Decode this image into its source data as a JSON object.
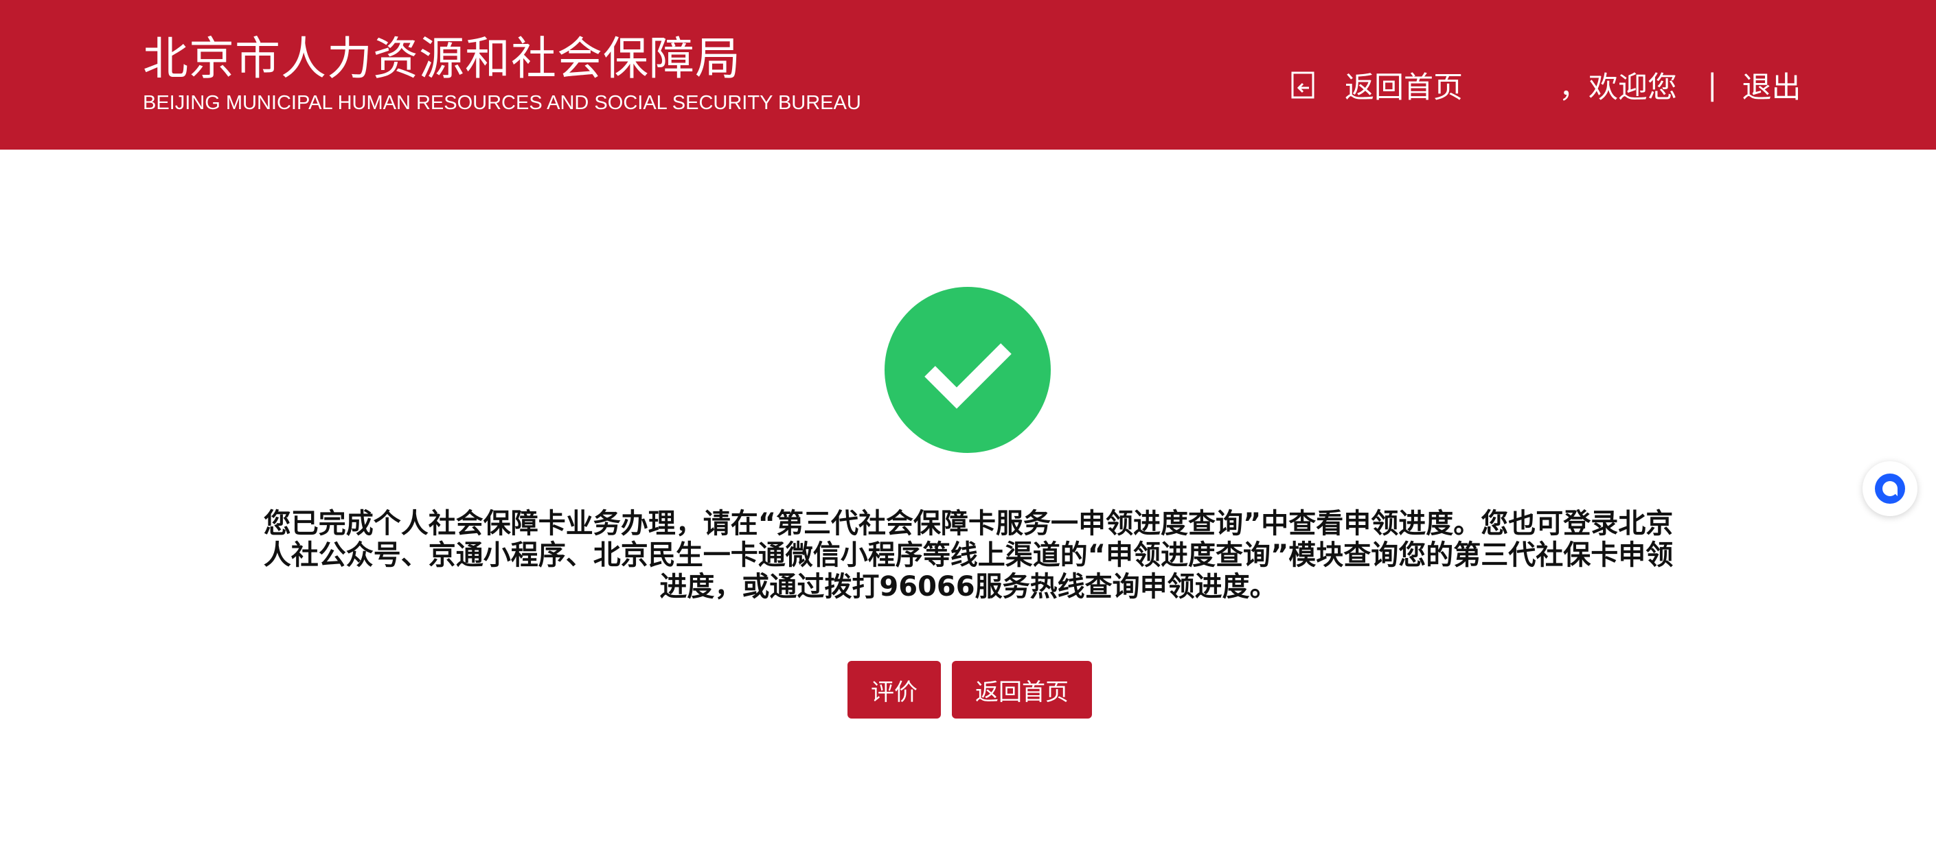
{
  "header": {
    "title": "北京市人力资源和社会保障局",
    "subtitle": "BEIJING MUNICIPAL HUMAN RESOURCES AND SOCIAL SECURITY BUREAU",
    "home_link": "返回首页",
    "welcome": "，欢迎您",
    "separator": "|",
    "logout": "退出"
  },
  "main": {
    "status_icon": "check-circle-icon",
    "message": "您已完成个人社会保障卡业务办理，请在“第三代社会保障卡服务一申领进度查询”中查看申领进度。您也可登录北京人社公众号、京通小程序、北京民生一卡通微信小程序等线上渠道的“申领进度查询”模块查询您的第三代社保卡申领进度，或通过拨打96066服务热线查询申领进度。",
    "buttons": {
      "evaluate": "评价",
      "back_home": "返回首页"
    }
  },
  "float_widget": {
    "icon": "chat-bubble-icon"
  },
  "colors": {
    "header_bg": "#bd1a2d",
    "button_bg": "#bd1a2d",
    "success_green": "#2bc466",
    "widget_blue": "#1a5cff"
  }
}
